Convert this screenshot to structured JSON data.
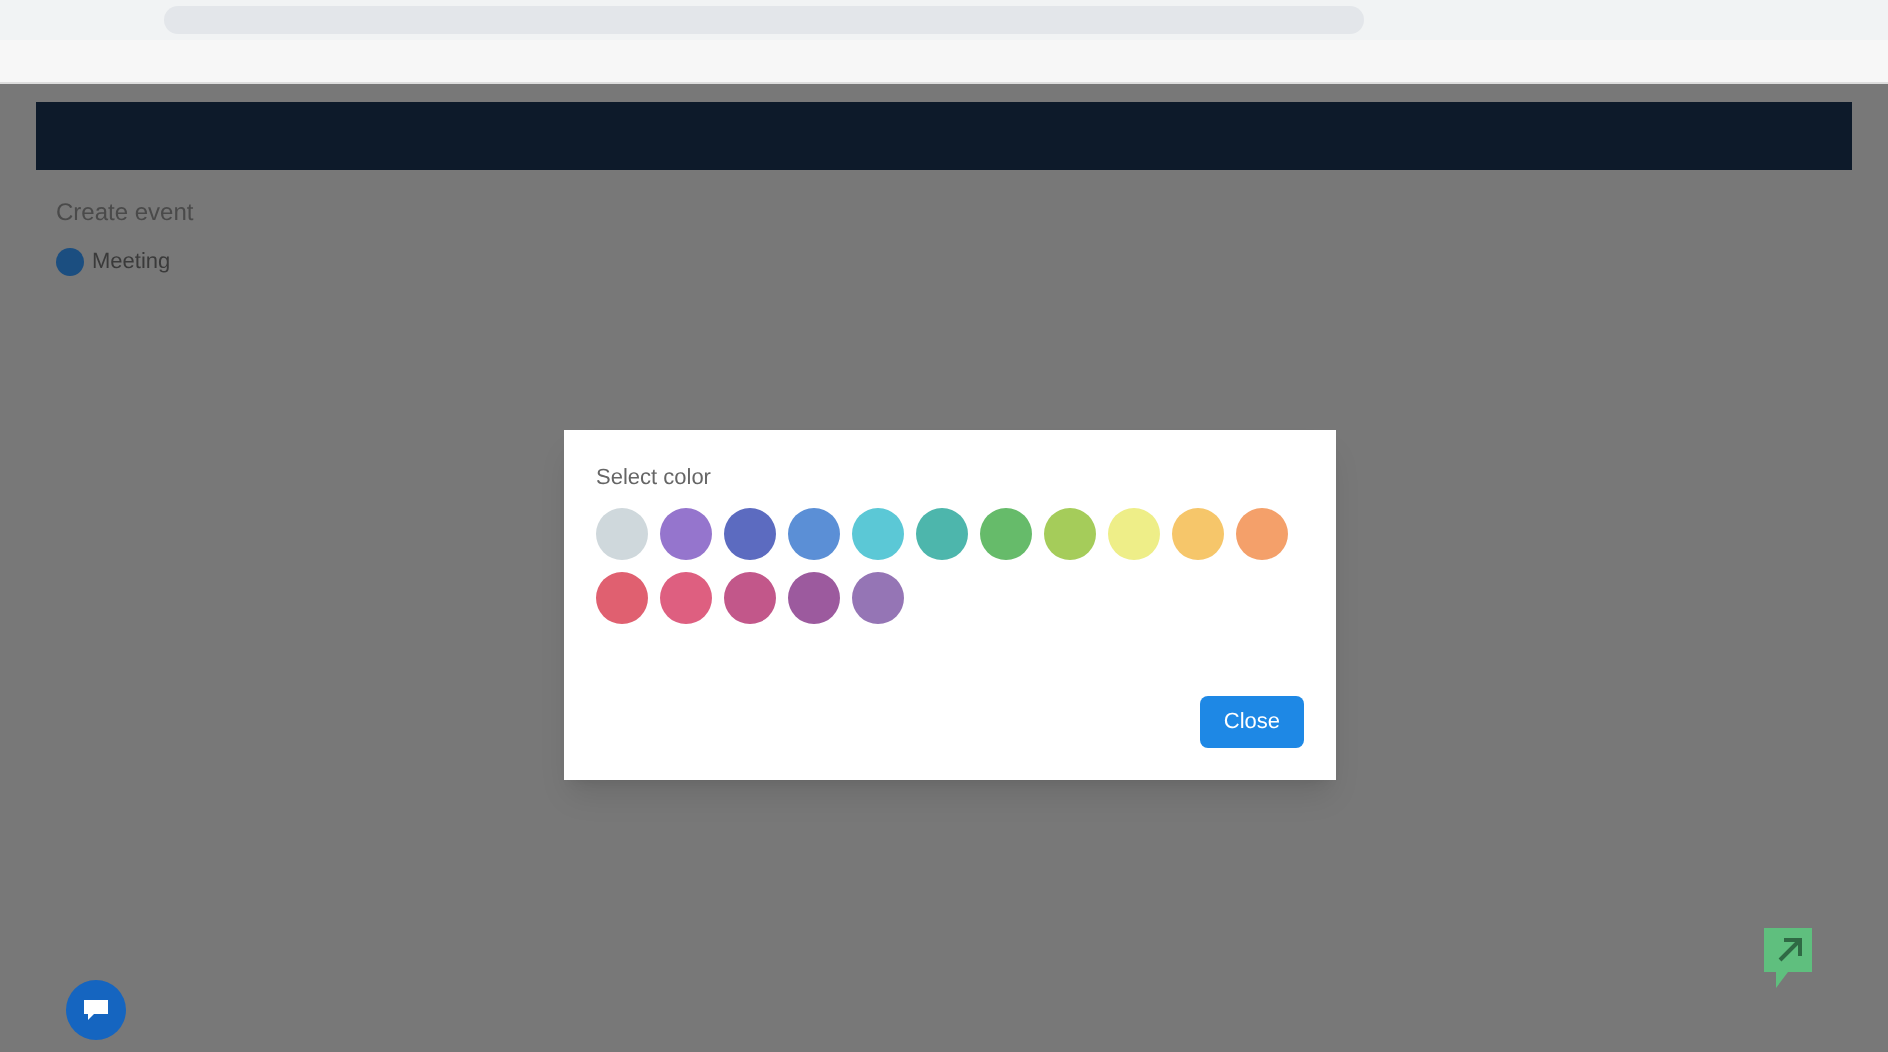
{
  "page": {
    "heading": "Create event",
    "step": "Meeting"
  },
  "dialog": {
    "title": "Select color",
    "colors": [
      {
        "color": "#cfd8dc"
      },
      {
        "color": "#9575cd"
      },
      {
        "color": "#5c6bc0"
      },
      {
        "color": "#5b8fd6"
      },
      {
        "color": "#5bc8d6"
      },
      {
        "color": "#4db6ac"
      },
      {
        "color": "#66bb6a"
      },
      {
        "color": "#a5cc5a"
      },
      {
        "color": "#eeee88"
      },
      {
        "color": "#f6c66a"
      },
      {
        "color": "#f4a06a"
      },
      {
        "color": "#e06070"
      },
      {
        "color": "#de5f80"
      },
      {
        "color": "#c2578a"
      },
      {
        "color": "#9c5a9e"
      },
      {
        "color": "#9575b5"
      }
    ],
    "button": "Close"
  }
}
